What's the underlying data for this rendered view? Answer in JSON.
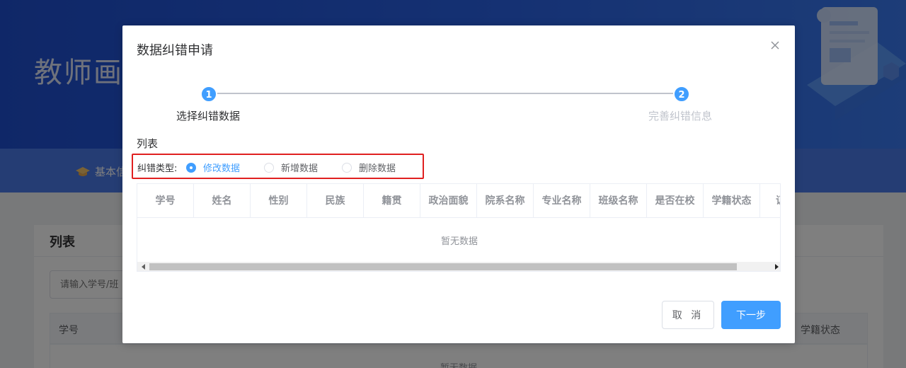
{
  "background": {
    "hero_title": "教师画像",
    "nav_item_label": "基本信",
    "card_title": "列表",
    "search_placeholder": "请输入学号/班",
    "table_headers": {
      "first": "学号",
      "last": "学籍状态"
    },
    "empty_text": "暂无数据"
  },
  "dialog": {
    "title": "数据纠错申请",
    "close_icon": "close-icon",
    "steps": [
      {
        "number": "1",
        "label": "选择纠错数据",
        "status": "active"
      },
      {
        "number": "2",
        "label": "完善纠错信息",
        "status": "pending"
      }
    ],
    "section_label": "列表",
    "correction_type": {
      "label": "纠错类型:",
      "selected": "修改数据",
      "options": [
        "修改数据",
        "新增数据",
        "删除数据"
      ]
    },
    "table": {
      "columns": [
        "学号",
        "姓名",
        "性别",
        "民族",
        "籍贯",
        "政治面貌",
        "院系名称",
        "专业名称",
        "班级名称",
        "是否在校",
        "学籍状态",
        "证"
      ],
      "empty_text": "暂无数据"
    },
    "buttons": {
      "cancel": "取 消",
      "next": "下一步"
    }
  },
  "colors": {
    "primary": "#409eff",
    "highlight_border": "#e02020",
    "hero": "#2a62e6"
  }
}
